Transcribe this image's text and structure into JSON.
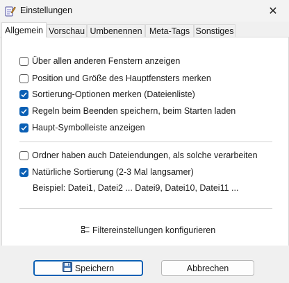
{
  "window": {
    "title": "Einstellungen",
    "app_icon": "pen-notepad-icon",
    "close_glyph": "✕"
  },
  "tabs": [
    {
      "label": "Allgemein",
      "active": true
    },
    {
      "label": "Vorschau",
      "active": false
    },
    {
      "label": "Umbenennen",
      "active": false
    },
    {
      "label": "Meta-Tags",
      "active": false
    },
    {
      "label": "Sonstiges",
      "active": false
    }
  ],
  "general": {
    "options": [
      {
        "label": "Über allen anderen Fenstern anzeigen",
        "checked": false
      },
      {
        "label": "Position und Größe des Hauptfensters merken",
        "checked": false
      },
      {
        "label": "Sortierung-Optionen merken (Dateienliste)",
        "checked": true
      },
      {
        "label": "Regeln beim Beenden speichern, beim Starten laden",
        "checked": true
      },
      {
        "label": "Haupt-Symbolleiste anzeigen",
        "checked": true
      }
    ],
    "sorting": [
      {
        "label": "Ordner haben auch Dateiendungen, als solche verarbeiten",
        "checked": false
      },
      {
        "label": "Natürliche Sortierung (2-3 Mal langsamer)",
        "checked": true
      }
    ],
    "example_text": "Beispiel: Datei1, Datei2 ... Datei9, Datei10, Datei11 ...",
    "filter_link": "Filtereinstellungen konfigurieren"
  },
  "buttons": {
    "save_label": "Speichern",
    "cancel_label": "Abbrechen"
  },
  "colors": {
    "accent": "#0a5fb4",
    "panel": "#ffffff",
    "chrome": "#f0f0f0"
  }
}
